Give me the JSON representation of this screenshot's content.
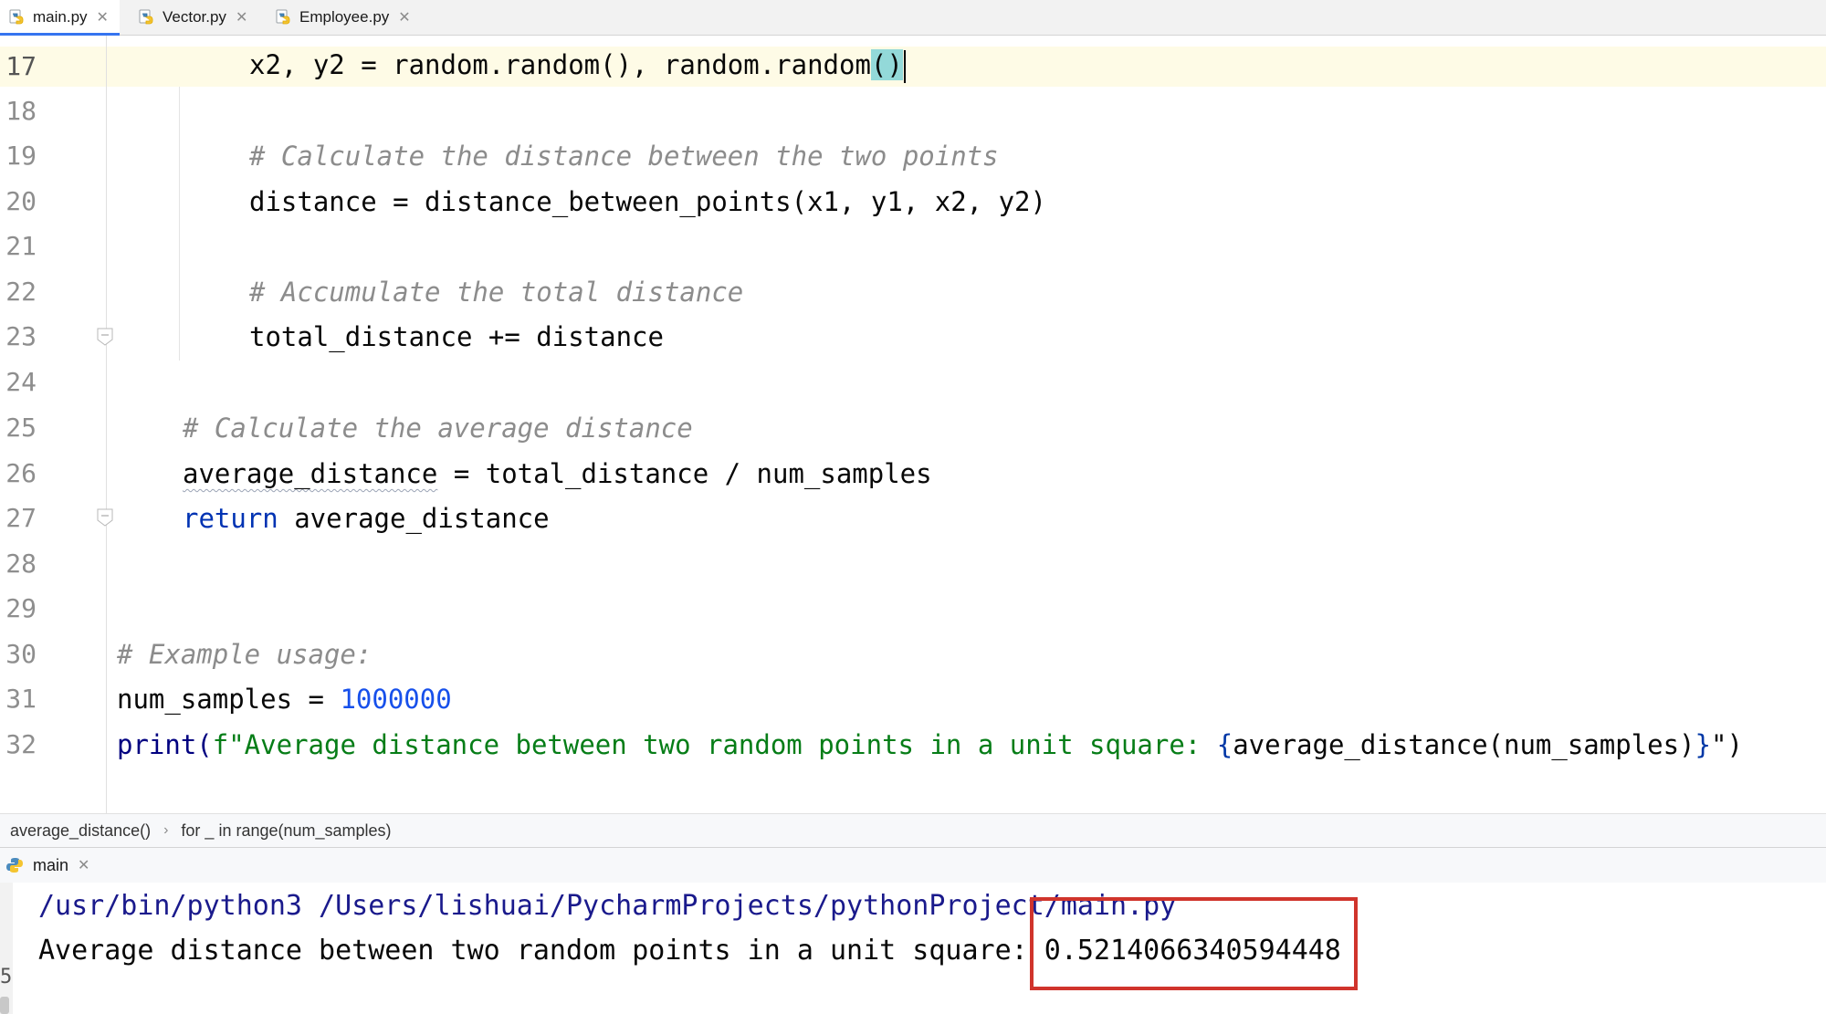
{
  "tabs": [
    {
      "label": "main.py",
      "active": true
    },
    {
      "label": "Vector.py",
      "active": false
    },
    {
      "label": "Employee.py",
      "active": false
    }
  ],
  "editor": {
    "line_numbers": [
      "17",
      "18",
      "19",
      "20",
      "21",
      "22",
      "23",
      "24",
      "25",
      "26",
      "27",
      "28",
      "29",
      "30",
      "31",
      "32"
    ],
    "lines": {
      "l17_a": "x2, y2 = random.random(), random.random",
      "l17_b": "()",
      "l19": "# Calculate the distance between the two points",
      "l20": "distance = distance_between_points(x1, y1, x2, y2)",
      "l22": "# Accumulate the total distance",
      "l23": "total_distance += distance",
      "l25": "# Calculate the average distance",
      "l26_a": "average_distance",
      "l26_b": " = total_distance / num_samples",
      "l27_kw": "return",
      "l27_b": " average_distance",
      "l30": "# Example usage:",
      "l31_a": "num_samples = ",
      "l31_num": "1000000",
      "l32_fn": "print(",
      "l32_str": "f\"Average distance between two random points in a unit square: ",
      "l32_br1": "{",
      "l32_expr": "average_distance(num_samples)",
      "l32_br2": "}",
      "l32_end": "\")"
    }
  },
  "breadcrumb": {
    "item1": "average_distance()",
    "item2": "for _ in range(num_samples)"
  },
  "run": {
    "tab_label": "main",
    "command": "/usr/bin/python3 /Users/lishuai/PycharmProjects/pythonProject/main.py",
    "output_prefix": "Average distance between two random points in a unit square: ",
    "output_value": "0.5214066340594448",
    "gutter_char": "5"
  },
  "colors": {
    "highlight_box": "#d0342c",
    "current_line": "#fefbe6",
    "active_tab_underline": "#3574f0"
  },
  "icons": [
    "python-file-icon",
    "close-icon",
    "chevron-right-icon",
    "fold-marker-icon"
  ]
}
